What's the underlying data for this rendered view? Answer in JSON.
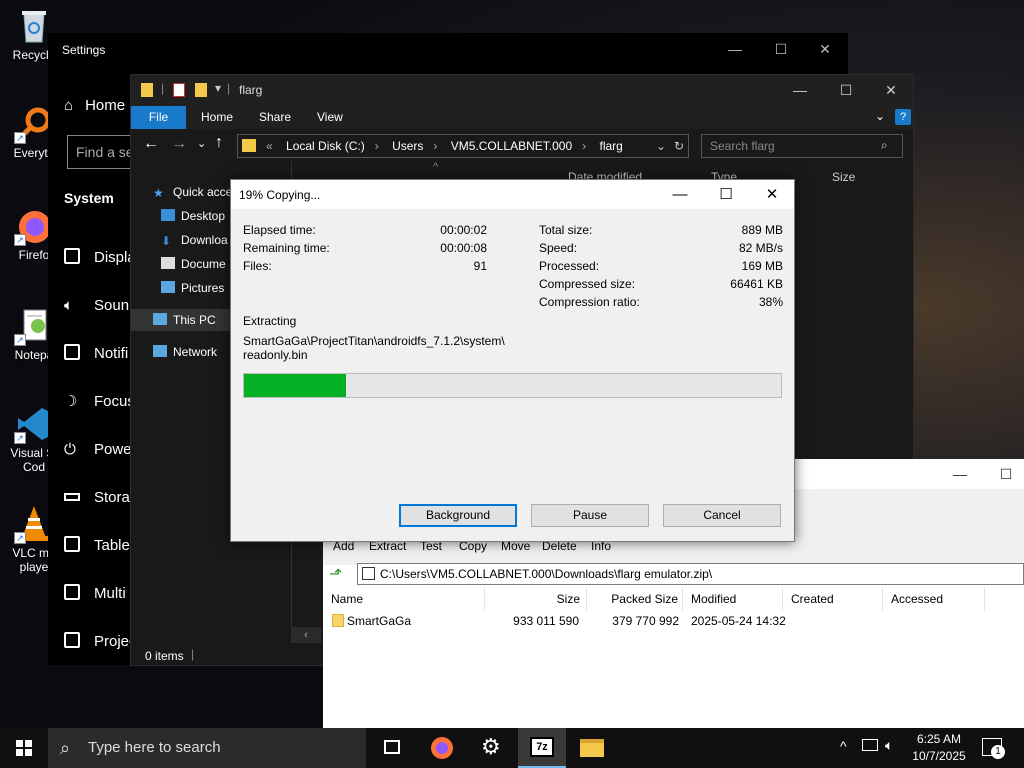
{
  "desktop": {
    "icons": [
      {
        "label": "Recycle"
      },
      {
        "label": "Everyth"
      },
      {
        "label": "Firefo"
      },
      {
        "label": "Notepa"
      },
      {
        "label": "Visual St",
        "label2": "Cod"
      },
      {
        "label": "VLC me",
        "label2": "playe"
      }
    ]
  },
  "settings": {
    "title": "Settings",
    "home": "Home",
    "search_placeholder": "Find a se",
    "section": "System",
    "items": [
      "Displa",
      "Soun",
      "Notifi",
      "Focus",
      "Powe",
      "Storag",
      "Tablet",
      "Multi",
      "Projec"
    ]
  },
  "explorer": {
    "title": "flarg",
    "tabs": [
      "File",
      "Home",
      "Share",
      "View"
    ],
    "address": [
      "Local Disk (C:)",
      "Users",
      "VM5.COLLABNET.000",
      "flarg"
    ],
    "search_placeholder": "Search flarg",
    "nav": [
      "Quick acce",
      "Desktop",
      "Downloa",
      "Docume",
      "Pictures",
      "This PC",
      "Network"
    ],
    "columns": [
      "Date modified",
      "Type",
      "Size"
    ],
    "status": "0 items"
  },
  "sevenzip": {
    "toolbar": [
      "Add",
      "Extract",
      "Test",
      "Copy",
      "Move",
      "Delete",
      "Info"
    ],
    "path": "C:\\Users\\VM5.COLLABNET.000\\Downloads\\flarg emulator.zip\\",
    "columns": [
      "Name",
      "Size",
      "Packed Size",
      "Modified",
      "Created",
      "Accessed"
    ],
    "rows": [
      {
        "name": "SmartGaGa",
        "size": "933 011 590",
        "packed": "379 770 992",
        "modified": "2025-05-24 14:32",
        "created": "",
        "accessed": ""
      }
    ]
  },
  "dialog": {
    "title": "19% Copying...",
    "left": [
      {
        "label": "Elapsed time:",
        "value": "00:00:02"
      },
      {
        "label": "Remaining time:",
        "value": "00:00:08"
      },
      {
        "label": "Files:",
        "value": "91"
      }
    ],
    "right": [
      {
        "label": "Total size:",
        "value": "889 MB"
      },
      {
        "label": "Speed:",
        "value": "82 MB/s"
      },
      {
        "label": "Processed:",
        "value": "169 MB"
      },
      {
        "label": "Compressed size:",
        "value": "66461 KB"
      },
      {
        "label": "Compression ratio:",
        "value": "38%"
      }
    ],
    "operation": "Extracting",
    "file_line1": "SmartGaGa\\ProjectTitan\\androidfs_7.1.2\\system\\",
    "file_line2": "readonly.bin",
    "progress": 0.19,
    "buttons": {
      "background": "Background",
      "pause": "Pause",
      "cancel": "Cancel"
    }
  },
  "taskbar": {
    "search_placeholder": "Type here to search",
    "time": "6:25 AM",
    "date": "10/7/2025",
    "notification_count": "1"
  },
  "colors": {
    "accent": "#1979ca",
    "progress": "#06b025",
    "firefox": "#ff7139",
    "vscode": "#2489ca",
    "vlc": "#f08a00"
  }
}
